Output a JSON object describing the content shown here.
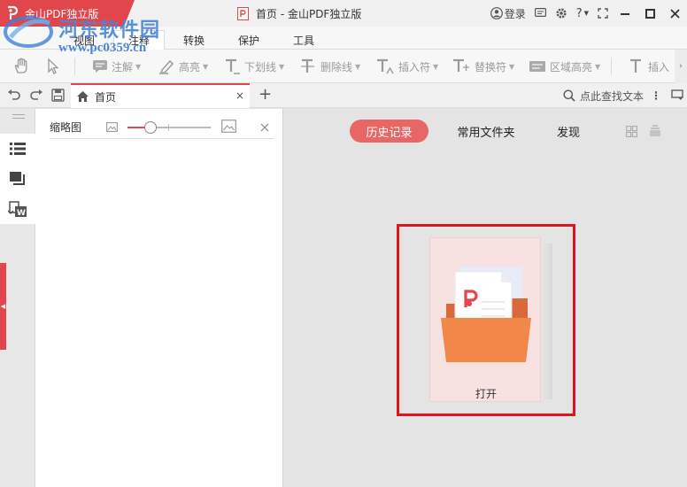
{
  "titlebar": {
    "app_title": "金山PDF独立版",
    "document_title": "首页 - 金山PDF独立版",
    "login_label": "登录",
    "help_label": "?"
  },
  "watermark": {
    "site_name": "河东软件园",
    "site_url": "www.pc0359.cn"
  },
  "menu": {
    "tabs": [
      "视图",
      "注释",
      "转换",
      "保护",
      "工具"
    ],
    "active": "注释"
  },
  "toolbar": {
    "annotate": "注解",
    "highlight": "高亮",
    "underline": "下划线",
    "strikethrough": "删除线",
    "insert_char": "插入符",
    "replace_char": "替换符",
    "area_highlight": "区域高亮",
    "insert": "插入"
  },
  "tabrow": {
    "home_tab": "首页",
    "close_icon": "×",
    "add_tab": "+",
    "search_placeholder": "点此查找文本"
  },
  "thumbnail_panel": {
    "title": "缩略图",
    "zoom_level": 0.28
  },
  "main": {
    "tabs": [
      "历史记录",
      "常用文件夹",
      "发现"
    ],
    "active_tab": "历史记录",
    "open_label": "打开"
  },
  "colors": {
    "accent": "#e0464c",
    "pill": "#e86666",
    "folder": "#f2874a",
    "highlight_box": "#e0141c"
  }
}
